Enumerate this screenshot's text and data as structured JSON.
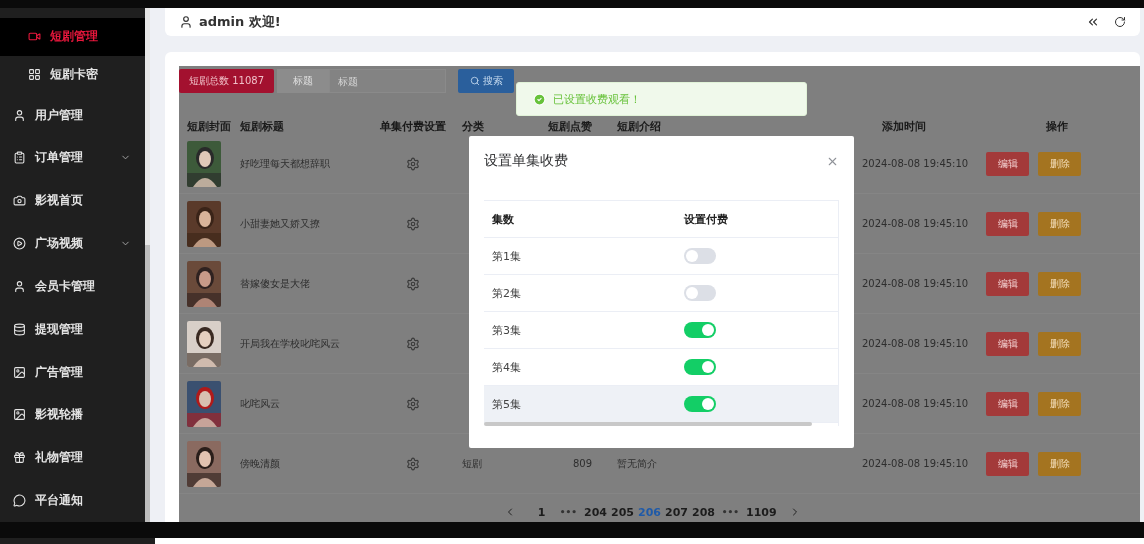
{
  "sidebar": {
    "items": [
      {
        "label": "短剧管理",
        "sub": true,
        "selected": true,
        "expandable": false
      },
      {
        "label": "短剧卡密",
        "sub": true,
        "selected": false,
        "expandable": false
      },
      {
        "label": "用户管理",
        "sub": false,
        "selected": false,
        "expandable": false
      },
      {
        "label": "订单管理",
        "sub": false,
        "selected": false,
        "expandable": true
      },
      {
        "label": "影视首页",
        "sub": false,
        "selected": false,
        "expandable": false
      },
      {
        "label": "广场视频",
        "sub": false,
        "selected": false,
        "expandable": true
      },
      {
        "label": "会员卡管理",
        "sub": false,
        "selected": false,
        "expandable": false
      },
      {
        "label": "提现管理",
        "sub": false,
        "selected": false,
        "expandable": false
      },
      {
        "label": "广告管理",
        "sub": false,
        "selected": false,
        "expandable": false
      },
      {
        "label": "影视轮播",
        "sub": false,
        "selected": false,
        "expandable": false
      },
      {
        "label": "礼物管理",
        "sub": false,
        "selected": false,
        "expandable": false
      },
      {
        "label": "平台通知",
        "sub": false,
        "selected": false,
        "expandable": false
      }
    ]
  },
  "header": {
    "greeting": "admin 欢迎!"
  },
  "toolbar": {
    "total": "短剧总数 11087",
    "field_label": "标题",
    "placeholder": "标题",
    "search": "搜索"
  },
  "toast": {
    "text": "已设置收费观看！"
  },
  "table": {
    "columns": [
      "短剧封面",
      "短剧标题",
      "单集付费设置",
      "分类",
      "短剧点赞",
      "短剧介绍",
      "添加时间",
      "操作"
    ],
    "rows": [
      {
        "title": "好吃理每天都想辞职",
        "time": "2024-08-08 19:45:10",
        "edit": "编辑",
        "delete": "删除"
      },
      {
        "title": "小甜妻她又娇又撩",
        "time": "2024-08-08 19:45:10",
        "edit": "编辑",
        "delete": "删除"
      },
      {
        "title": "替嫁傻女是大佬",
        "time": "2024-08-08 19:45:10",
        "edit": "编辑",
        "delete": "删除"
      },
      {
        "title": "开局我在学校叱咤风云",
        "time": "2024-08-08 19:45:10",
        "edit": "编辑",
        "delete": "删除"
      },
      {
        "title": "叱咤风云",
        "time": "2024-08-08 19:45:10",
        "edit": "编辑",
        "delete": "删除"
      },
      {
        "title": "傍晚清颜",
        "category": "短剧",
        "likes": "809",
        "intro": "暂无简介",
        "time": "2024-08-08 19:45:10",
        "edit": "编辑",
        "delete": "删除"
      }
    ]
  },
  "pagination": {
    "pages": [
      {
        "label": "1",
        "kind": "page",
        "selected": false
      },
      {
        "label": "•••",
        "kind": "more",
        "selected": false
      },
      {
        "label": "204",
        "kind": "page",
        "selected": false
      },
      {
        "label": "205",
        "kind": "page",
        "selected": false
      },
      {
        "label": "206",
        "kind": "page",
        "selected": true
      },
      {
        "label": "207",
        "kind": "page",
        "selected": false
      },
      {
        "label": "208",
        "kind": "page",
        "selected": false
      },
      {
        "label": "•••",
        "kind": "more",
        "selected": false
      },
      {
        "label": "1109",
        "kind": "page",
        "selected": false
      }
    ]
  },
  "dialog": {
    "title": "设置单集收费",
    "columns": [
      "集数",
      "设置付费"
    ],
    "episodes": [
      {
        "label": "第1集",
        "paid": false,
        "selected": false
      },
      {
        "label": "第2集",
        "paid": false,
        "selected": false
      },
      {
        "label": "第3集",
        "paid": true,
        "selected": false
      },
      {
        "label": "第4集",
        "paid": true,
        "selected": false
      },
      {
        "label": "第5集",
        "paid": true,
        "selected": true
      }
    ]
  }
}
